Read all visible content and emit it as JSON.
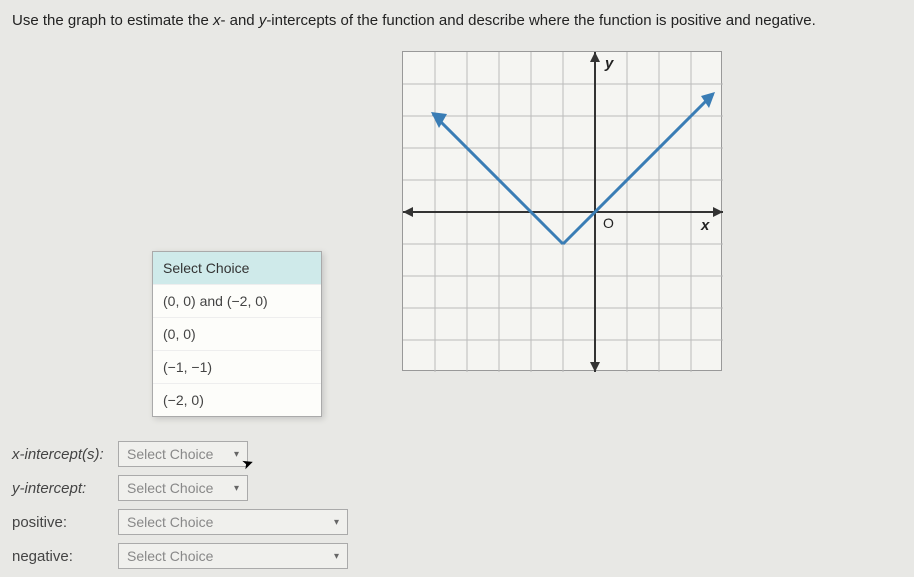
{
  "question": {
    "prefix": "Use the graph to estimate the ",
    "var_x": "x",
    "mid1": "- and ",
    "var_y": "y",
    "suffix": "-intercepts of the function and describe where the function is positive and negative."
  },
  "graph": {
    "y_label": "y",
    "x_label": "x",
    "origin_label": "O"
  },
  "dropdown": {
    "header": "Select Choice",
    "options": [
      "(0, 0) and (−2, 0)",
      "(0, 0)",
      "(−1, −1)",
      "(−2, 0)"
    ]
  },
  "answers": {
    "x_intercept": {
      "label": "x-intercept(s):",
      "placeholder": "Select Choice"
    },
    "y_intercept": {
      "label": "y-intercept:",
      "placeholder": "Select Choice"
    },
    "positive": {
      "label": "positive:",
      "placeholder": "Select Choice"
    },
    "negative": {
      "label": "negative:",
      "placeholder": "Select Choice"
    }
  }
}
